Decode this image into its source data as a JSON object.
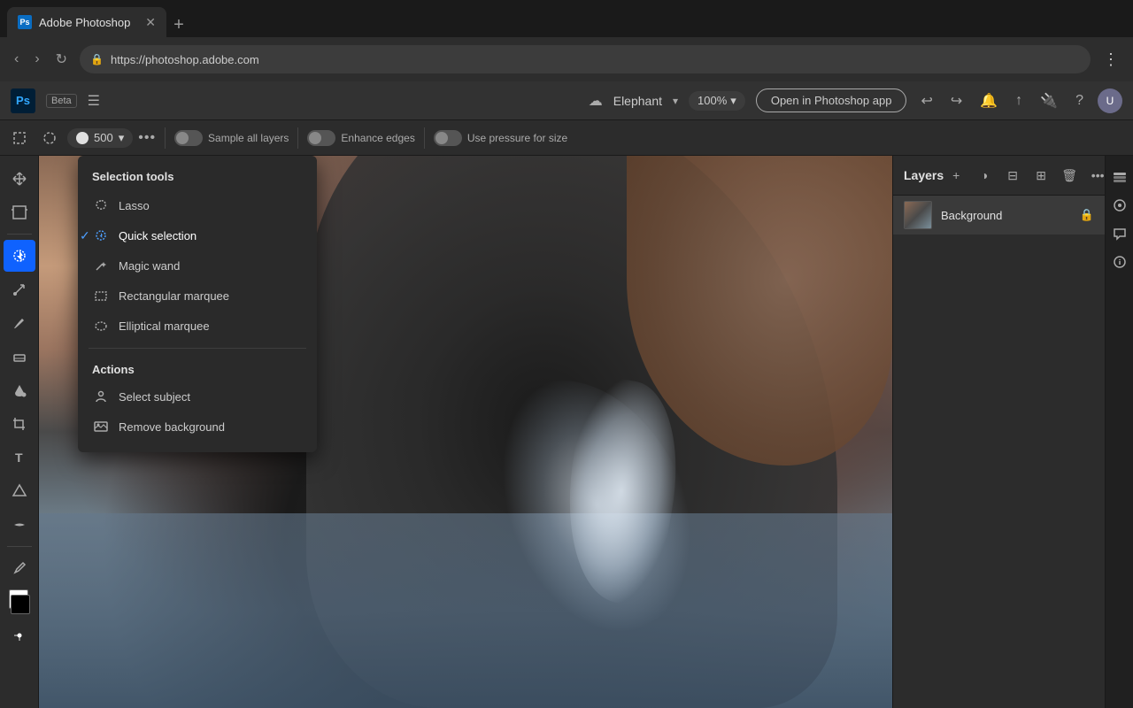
{
  "browser": {
    "tab_title": "Adobe Photoshop",
    "tab_icon": "Ps",
    "url": "https://photoshop.adobe.com",
    "new_tab_label": "+"
  },
  "app_header": {
    "logo_text": "Ps",
    "beta_label": "Beta",
    "hamburger_label": "☰",
    "file_name": "Elephant",
    "zoom_level": "100%",
    "open_in_photoshop_label": "Open in Photoshop app",
    "undo_icon": "↩",
    "redo_icon": "↪"
  },
  "toolbar": {
    "selection_box_icon": "⬜",
    "selection_ellipse_icon": "⊡",
    "brush_size": "500",
    "more_label": "•••",
    "sample_all_layers": "Sample all layers",
    "enhance_edges": "Enhance edges",
    "use_pressure": "Use pressure for size"
  },
  "selection_menu": {
    "section_title": "Selection tools",
    "items": [
      {
        "id": "lasso",
        "label": "Lasso",
        "icon": "lasso",
        "selected": false
      },
      {
        "id": "quick-selection",
        "label": "Quick selection",
        "icon": "quick-selection",
        "selected": true
      },
      {
        "id": "magic-wand",
        "label": "Magic wand",
        "icon": "magic-wand",
        "selected": false
      },
      {
        "id": "rectangular-marquee",
        "label": "Rectangular marquee",
        "icon": "rect-marquee",
        "selected": false
      },
      {
        "id": "elliptical-marquee",
        "label": "Elliptical marquee",
        "icon": "ellipse-marquee",
        "selected": false
      }
    ],
    "actions_title": "Actions",
    "actions": [
      {
        "id": "select-subject",
        "label": "Select subject",
        "icon": "person-icon"
      },
      {
        "id": "remove-background",
        "label": "Remove background",
        "icon": "image-icon"
      }
    ]
  },
  "layers_panel": {
    "title": "Layers",
    "add_icon": "+",
    "layer": {
      "name": "Background",
      "lock_icon": "🔒"
    }
  }
}
